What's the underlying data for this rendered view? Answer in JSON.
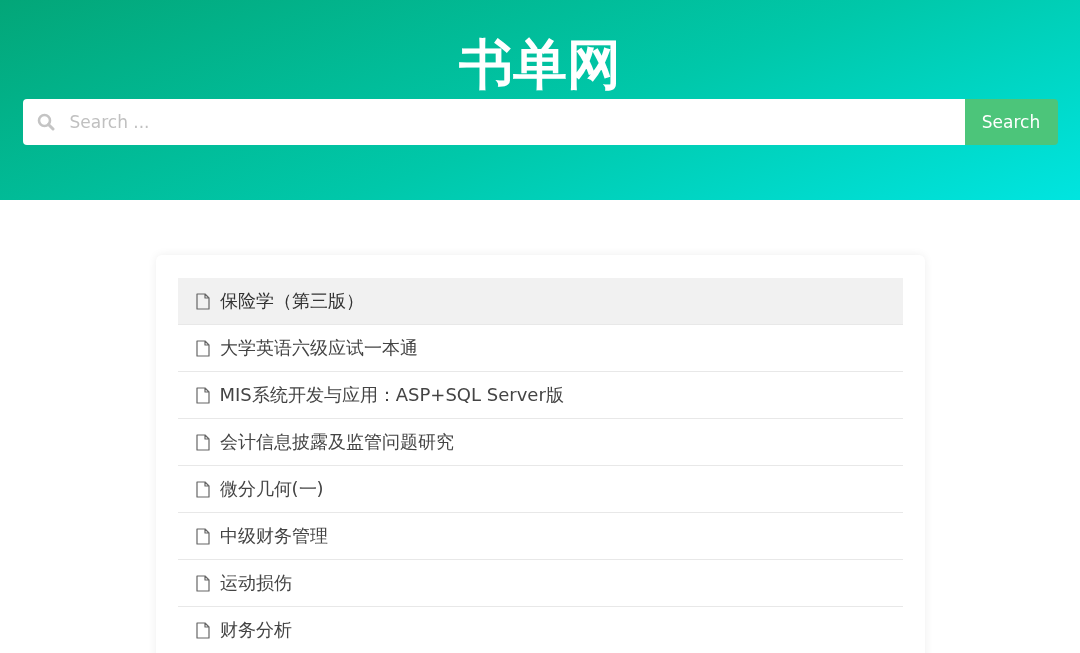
{
  "header": {
    "title": "书单网",
    "search": {
      "placeholder": "Search ...",
      "button": "Search"
    }
  },
  "books": [
    {
      "title": "保险学（第三版）",
      "selected": true
    },
    {
      "title": "大学英语六级应试一本通",
      "selected": false
    },
    {
      "title": "MIS系统开发与应用：ASP+SQL Server版",
      "selected": false
    },
    {
      "title": "会计信息披露及监管问题研究",
      "selected": false
    },
    {
      "title": "微分几何(一)",
      "selected": false
    },
    {
      "title": "中级财务管理",
      "selected": false
    },
    {
      "title": "运动损伤",
      "selected": false
    },
    {
      "title": "财务分析",
      "selected": false
    }
  ]
}
